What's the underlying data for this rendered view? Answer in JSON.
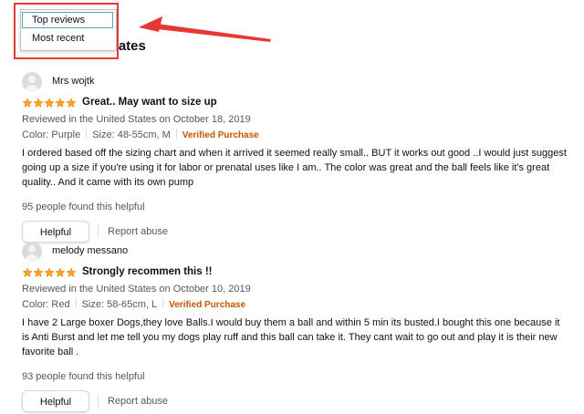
{
  "sort_menu": {
    "options": [
      "Top reviews",
      "Most recent"
    ],
    "selected": "Top reviews"
  },
  "section_heading": "n the United States",
  "annotation": {
    "color": "#e53935"
  },
  "colors": {
    "star": "#ffa41c",
    "verified": "#c45500",
    "muted_text": "#565959"
  },
  "reviews": [
    {
      "author": "Mrs wojtk",
      "rating": 5,
      "title": "Great.. May want to size up",
      "date": "Reviewed in the United States on October 18, 2019",
      "color": "Color: Purple",
      "size": "Size: 48-55cm, M",
      "verified": "Verified Purchase",
      "body": "I ordered based off the sizing chart and when it arrived it seemed really small.. BUT it works out good ..I would just suggest going up a size if you're using it for labor or prenatal uses like I am.. The color was great and the ball feels like it's great quality.. And it came with its own pump",
      "helpful_count": "95 people found this helpful",
      "helpful_label": "Helpful",
      "report_label": "Report abuse"
    },
    {
      "author": "melody messano",
      "rating": 5,
      "title": "Strongly recommen this !!",
      "date": "Reviewed in the United States on October 10, 2019",
      "color": "Color: Red",
      "size": "Size: 58-65cm, L",
      "verified": "Verified Purchase",
      "body": "I have 2 Large boxer Dogs,they love Balls.I would buy them a ball and within 5 min its busted.I bought this one because it is Anti Burst and let me tell you my dogs play ruff and this ball can take it. They cant wait to go out and play it is their new favorite ball .",
      "helpful_count": "93 people found this helpful",
      "helpful_label": "Helpful",
      "report_label": "Report abuse"
    }
  ]
}
